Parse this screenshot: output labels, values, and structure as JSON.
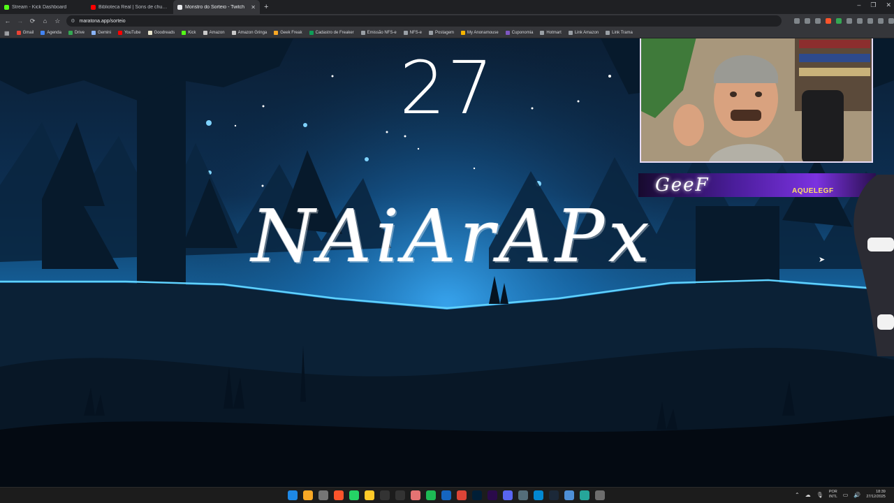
{
  "browser": {
    "tabs": [
      {
        "title": "Stream - Kick Dashboard",
        "favicon_color": "#53fc18",
        "active": false
      },
      {
        "title": "Biblioteca Real | Sons de chuva e tro...",
        "favicon_color": "#ff0000",
        "active": false
      },
      {
        "title": "Monstro do Sorteio - Twitch",
        "favicon_color": "#e8eaed",
        "active": true
      }
    ],
    "new_tab_icon": "plus-icon",
    "url": "maratona.app/sorteio",
    "bookmarks": [
      {
        "label": "Gmail",
        "color": "#ea4335"
      },
      {
        "label": "Agenda",
        "color": "#4285f4"
      },
      {
        "label": "Drive",
        "color": "#34a853"
      },
      {
        "label": "Gemini",
        "color": "#8ab4f8"
      },
      {
        "label": "YouTube",
        "color": "#ff0000"
      },
      {
        "label": "Goodreads",
        "color": "#e9e5cd"
      },
      {
        "label": "Kick",
        "color": "#53fc18"
      },
      {
        "label": "Amazon",
        "color": "#c9c9c9"
      },
      {
        "label": "Amazon Gringa",
        "color": "#c9c9c9"
      },
      {
        "label": "Geek Freak",
        "color": "#f9a825"
      },
      {
        "label": "Cadastro de Freaker",
        "color": "#0f9d58"
      },
      {
        "label": "Emissão NFS-e",
        "color": "#9aa0a6"
      },
      {
        "label": "NFS-e",
        "color": "#9aa0a6"
      },
      {
        "label": "Postagem",
        "color": "#9aa0a6"
      },
      {
        "label": "My Anonamouse",
        "color": "#f4b400"
      },
      {
        "label": "Cuponomia",
        "color": "#7e57c2"
      },
      {
        "label": "Hotmart",
        "color": "#9aa0a6"
      },
      {
        "label": "Link Amazon",
        "color": "#9aa0a6"
      },
      {
        "label": "Link Trama",
        "color": "#9aa0a6"
      }
    ]
  },
  "page": {
    "counter": "27",
    "winner_name": "NAiArAPx"
  },
  "stream_overlay": {
    "channel_name": "AQUELEGF",
    "logo_text": "GeeF"
  },
  "taskbar": {
    "apps": [
      {
        "name": "start",
        "color": "#1e88e5"
      },
      {
        "name": "explorer",
        "color": "#f9a825"
      },
      {
        "name": "settings",
        "color": "#757575"
      },
      {
        "name": "brave",
        "color": "#fb542b"
      },
      {
        "name": "whatsapp",
        "color": "#25d366"
      },
      {
        "name": "notes",
        "color": "#ffca28"
      },
      {
        "name": "x",
        "color": "#333333"
      },
      {
        "name": "capcut",
        "color": "#333333"
      },
      {
        "name": "app",
        "color": "#e57373"
      },
      {
        "name": "spotify",
        "color": "#1db954"
      },
      {
        "name": "app",
        "color": "#1565c0"
      },
      {
        "name": "chrome",
        "color": "#db4437"
      },
      {
        "name": "photoshop",
        "color": "#001e36"
      },
      {
        "name": "premiere",
        "color": "#2a0a4a"
      },
      {
        "name": "discord",
        "color": "#5865f2"
      },
      {
        "name": "app",
        "color": "#546e7a"
      },
      {
        "name": "photos",
        "color": "#0288d1"
      },
      {
        "name": "steam",
        "color": "#1b2838"
      },
      {
        "name": "app",
        "color": "#4e8fd6"
      },
      {
        "name": "obs",
        "color": "#26a69a"
      },
      {
        "name": "app",
        "color": "#6d6d6d"
      }
    ],
    "lang_top": "POR",
    "lang_bottom": "INTL",
    "time": "18:39",
    "date": "27/12/2025"
  }
}
